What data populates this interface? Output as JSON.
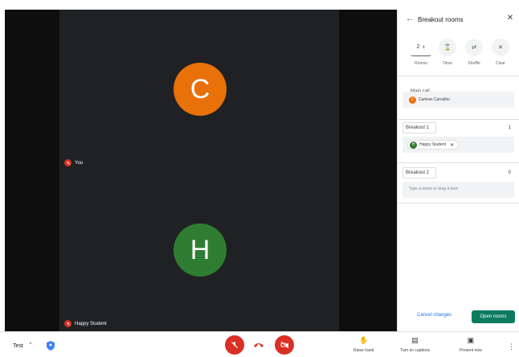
{
  "video": {
    "participants": [
      {
        "initial": "C",
        "color": "#e8710a"
      },
      {
        "initial": "H",
        "color": "#2e7d32"
      }
    ],
    "top_tag": "You",
    "bottom_tag": "Happy Student"
  },
  "panel": {
    "title": "Breakout rooms",
    "tools": {
      "rooms_value": "2",
      "rooms_label": "Rooms",
      "timer_label": "Timer",
      "shuffle_label": "Shuffle",
      "clear_label": "Clear"
    },
    "main_call": {
      "label": "Main call",
      "member": {
        "initial": "C",
        "name": "Carlean Carvalho",
        "color": "#e8710a"
      }
    },
    "breakout1": {
      "name": "Breakout 1",
      "count": "1",
      "member": {
        "initial": "H",
        "name": "Happy Student",
        "color": "#2e7d32"
      }
    },
    "breakout2": {
      "name": "Breakout 2",
      "count": "0",
      "placeholder": "Type a name or drag it here"
    },
    "footer": {
      "cancel_label": "Cancel changes",
      "open_label": "Open rooms"
    }
  },
  "bottom_bar": {
    "meeting_name": "Test",
    "raise_hand_label": "Raise hand",
    "captions_label": "Turn on captions",
    "present_label": "Present now"
  },
  "colors": {
    "accent_green": "#0d7a60",
    "danger_red": "#d93025",
    "link_blue": "#1a73e8"
  }
}
